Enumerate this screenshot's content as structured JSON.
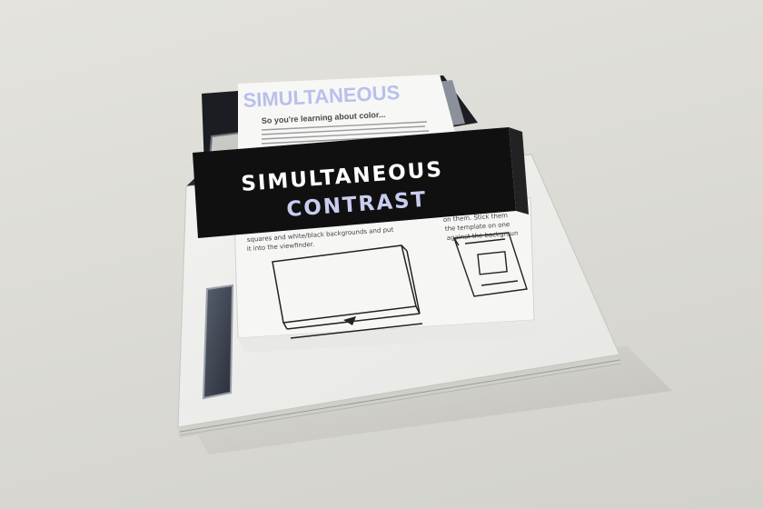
{
  "photo": {
    "subject": "booklet-kit-on-table",
    "colors": {
      "background": "#dcdbd5",
      "band": "#101010",
      "band_text_line1": "#ffffff",
      "band_text_line2": "#c8cdf0",
      "header_text": "#b8c0ec"
    }
  },
  "band": {
    "line1": "SIMULTANEOUS",
    "line2": "CONTRAST"
  },
  "top_sheet": {
    "header": "SIMULTANEOUS",
    "heading": "So you're learning about color..."
  },
  "instruction_sheet": {
    "left_text_1": "squares and white/black backgrounds and put",
    "left_text_2": "it into the viewfinder.",
    "right_text_1": "on them. Stick them",
    "right_text_2": "the template on one",
    "right_text_3": "against the backgroun"
  }
}
